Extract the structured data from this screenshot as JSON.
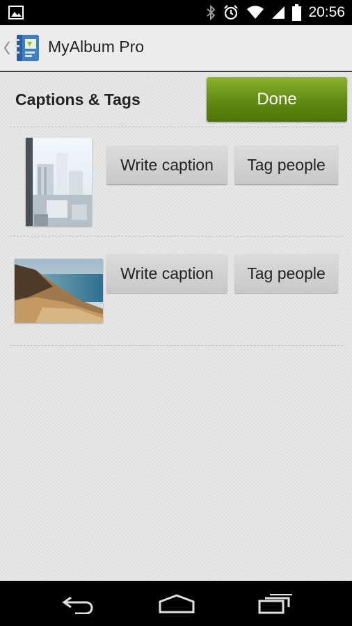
{
  "status_bar": {
    "time": "20:56",
    "icons": [
      "image-notification-icon",
      "bluetooth-icon",
      "alarm-icon",
      "wifi-icon",
      "cell-signal-icon",
      "battery-icon"
    ]
  },
  "action_bar": {
    "title": "MyAlbum Pro",
    "icons": [
      "up-caret-icon",
      "app-icon"
    ]
  },
  "header": {
    "title": "Captions & Tags",
    "done_label": "Done",
    "done_color": "#6b9619"
  },
  "photos": [
    {
      "thumbnail": "city-buildings-photo",
      "caption_label": "Write caption",
      "tag_label": "Tag people"
    },
    {
      "thumbnail": "beach-dune-photo",
      "caption_label": "Write caption",
      "tag_label": "Tag people"
    }
  ],
  "nav_bar": {
    "icons": [
      "back-icon",
      "home-icon",
      "recent-apps-icon"
    ]
  }
}
